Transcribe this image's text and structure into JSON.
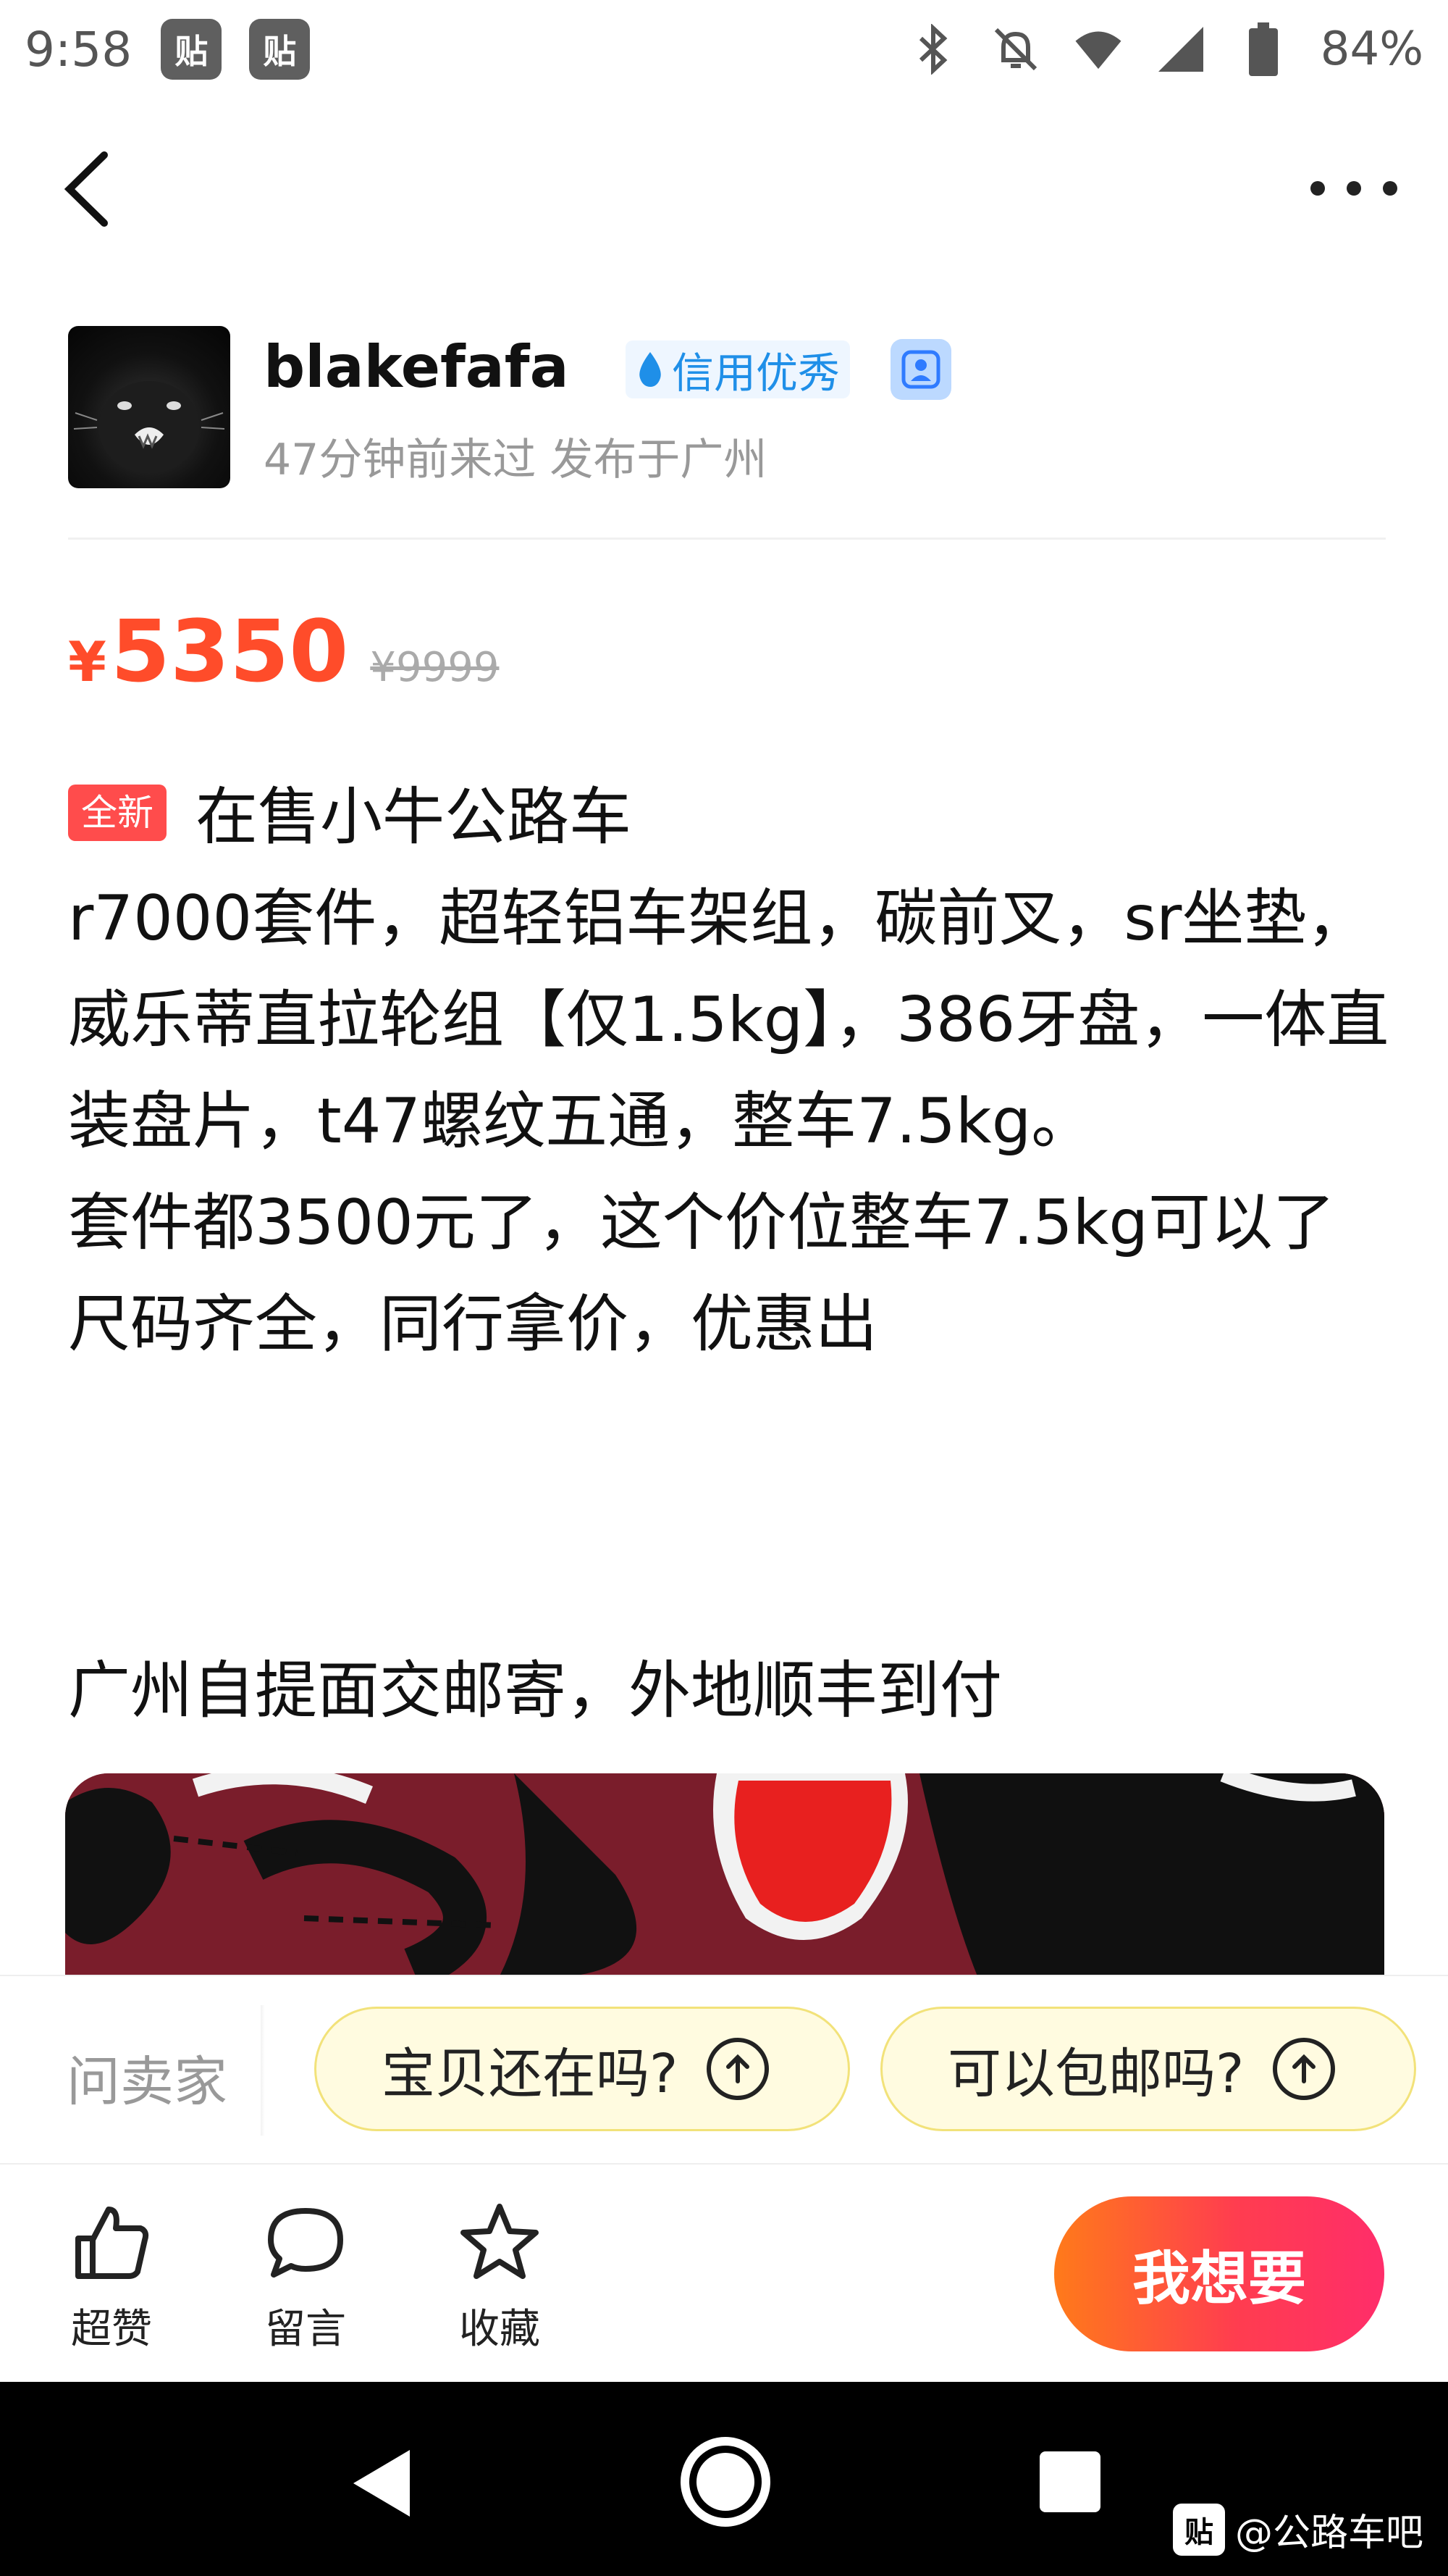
{
  "status_bar": {
    "time": "9:58",
    "notif_badge_1": "贴",
    "notif_badge_2": "贴",
    "battery": "84%",
    "icons": [
      "bluetooth-icon",
      "mute-icon",
      "wifi-icon",
      "signal-icon",
      "battery-icon"
    ]
  },
  "seller": {
    "username": "blakefafa",
    "credit_label": "信用优秀",
    "subtitle": "47分钟前来过 发布于广州"
  },
  "price": {
    "symbol": "¥",
    "current": "5350",
    "original": "¥9999"
  },
  "listing": {
    "new_tag": "全新",
    "description": "在售小牛公路车\nr7000套件，超轻铝车架组，碳前叉，sr坐垫，威乐蒂直拉轮组【仅1.5kg】，386牙盘，一体直装盘片，t47螺纹五通，整车7.5kg。\n套件都3500元了，这个价位整车7.5kg可以了\n尺码齐全，同行拿价，优惠出",
    "description_2": "广州自提面交邮寄，外地顺丰到付"
  },
  "ask": {
    "label": "问卖家",
    "questions": [
      "宝贝还在吗?",
      "可以包邮吗?"
    ]
  },
  "actions": {
    "like": "超赞",
    "comment": "留言",
    "favorite": "收藏",
    "want": "我想要"
  },
  "watermark": {
    "badge": "贴",
    "text": "@公路车吧"
  },
  "colors": {
    "price": "#ff4c2a",
    "credit": "#1f8fe8",
    "want_gradient_start": "#ff7a1a",
    "want_gradient_end": "#ff2d6a"
  }
}
